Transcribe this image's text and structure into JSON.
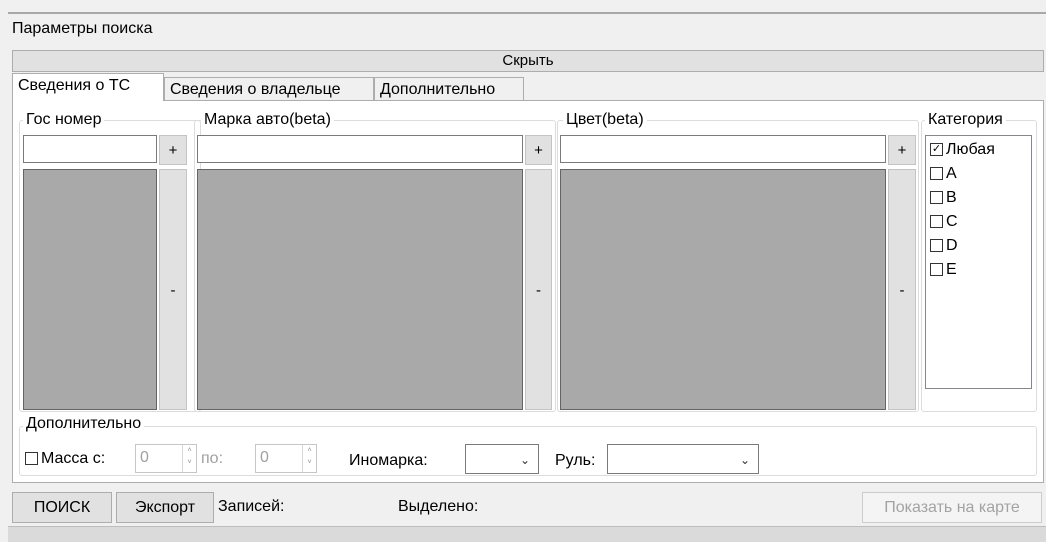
{
  "search_panel": {
    "title": "Параметры поиска",
    "hide_label": "Скрыть"
  },
  "tabs": [
    {
      "label": "Сведения о ТС",
      "active": true
    },
    {
      "label": "Сведения о владельце",
      "active": false
    },
    {
      "label": "Дополнительно",
      "active": false
    }
  ],
  "groups": {
    "plate": {
      "legend": "Гос номер",
      "value": "",
      "add": "+",
      "remove": "-"
    },
    "brand": {
      "legend": "Марка авто(beta)",
      "value": "",
      "add": "+",
      "remove": "-"
    },
    "color": {
      "legend": "Цвет(beta)",
      "value": "",
      "add": "+",
      "remove": "-"
    }
  },
  "category": {
    "legend": "Категория",
    "items": [
      {
        "label": "Любая",
        "checked": true
      },
      {
        "label": "A",
        "checked": false
      },
      {
        "label": "B",
        "checked": false
      },
      {
        "label": "C",
        "checked": false
      },
      {
        "label": "D",
        "checked": false
      },
      {
        "label": "E",
        "checked": false
      }
    ]
  },
  "extra": {
    "legend": "Дополнительно",
    "mass_label": "Масса с:",
    "mass_from": "0",
    "to_label": "по:",
    "mass_to": "0",
    "foreign_label": "Иномарка:",
    "foreign_value": "",
    "wheel_label": "Руль:",
    "wheel_value": ""
  },
  "bottom": {
    "search": "ПОИСК",
    "export": "Экспорт",
    "records": "Записей:",
    "selected": "Выделено:",
    "show_map": "Показать на карте"
  },
  "checkbox_checked": "✓",
  "checkbox_unchecked": ""
}
